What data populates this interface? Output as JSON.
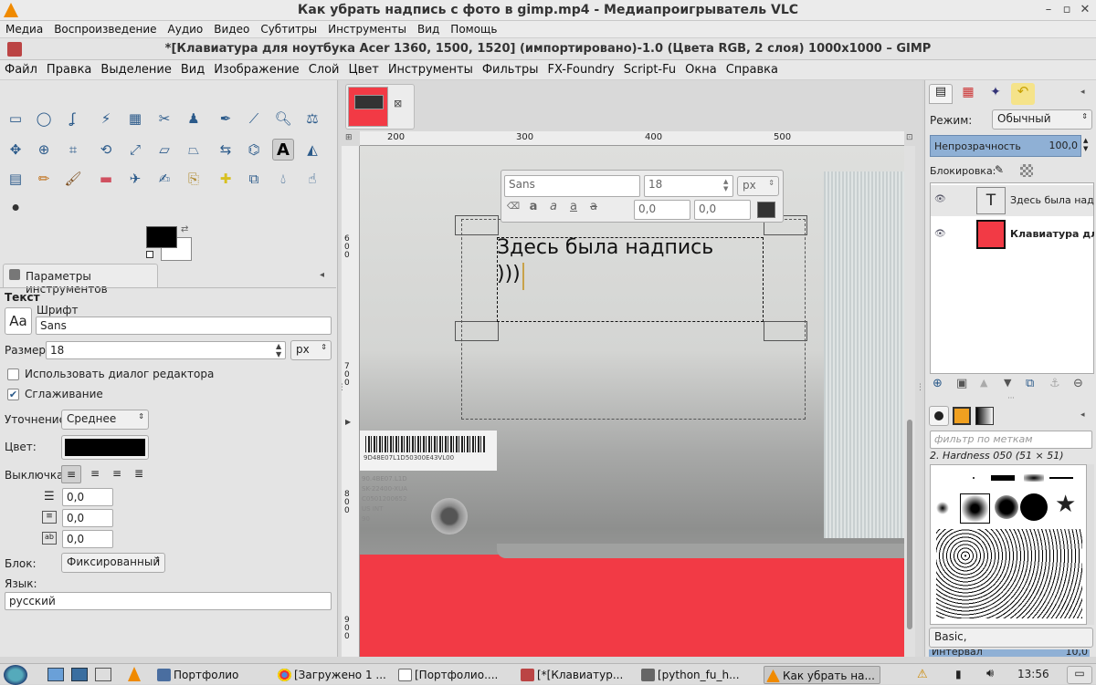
{
  "vlc": {
    "title": "Как убрать надпись с фото в gimp.mp4 - Медиапроигрыватель VLC",
    "menu": [
      "Медиа",
      "Воспроизведение",
      "Аудио",
      "Видео",
      "Субтитры",
      "Инструменты",
      "Вид",
      "Помощь"
    ]
  },
  "gimp": {
    "title": "*[Клавиатура для ноутбука Acer 1360, 1500, 1520] (импортировано)-1.0 (Цвета RGB, 2 слоя) 1000x1000 – GIMP",
    "menu": [
      "Файл",
      "Правка",
      "Выделение",
      "Вид",
      "Изображение",
      "Слой",
      "Цвет",
      "Инструменты",
      "Фильтры",
      "FX-Foundry",
      "Script-Fu",
      "Окна",
      "Справка"
    ]
  },
  "tool_options": {
    "tab_label": "Параметры инструментов",
    "section": "Текст",
    "font_label": "Шрифт",
    "font_value": "Sans",
    "size_label": "Размер:",
    "size_value": "18",
    "size_unit": "px",
    "use_editor_label": "Использовать диалог редактора",
    "antialias_label": "Сглаживание",
    "hinting_label": "Уточнение:",
    "hinting_value": "Среднее",
    "color_label": "Цвет:",
    "justify_label": "Выключка:",
    "indent_value": "0,0",
    "line_spacing_value": "0,0",
    "letter_spacing_value": "0,0",
    "box_label": "Блок:",
    "box_value": "Фиксированный",
    "language_label": "Язык:",
    "language_value": "русский",
    "font_preview": "Aa"
  },
  "rulers": {
    "top": [
      "200",
      "300",
      "400",
      "500"
    ],
    "left": [
      "600",
      "700",
      "800",
      "900"
    ]
  },
  "text_overlay": {
    "font": "Sans",
    "size": "18",
    "unit": "px",
    "baseline": "0,0",
    "kerning": "0,0",
    "canvas_text_line1": "Здесь была надпись",
    "canvas_text_line2": ")))"
  },
  "image_labels": {
    "label_line1": "9D48E07L1D50300E43VL00",
    "sticker_lines": [
      "90.4BE07.L1D",
      "SK-22400-XUA",
      "C0501200652",
      "US INT",
      "90"
    ]
  },
  "layers": {
    "mode_label": "Режим:",
    "mode_value": "Обычный",
    "opacity_label": "Непрозрачность",
    "opacity_value": "100,0",
    "lock_label": "Блокировка:",
    "items": [
      {
        "name": "Здесь была надпись",
        "type": "text"
      },
      {
        "name": "Клавиатура для ноутбука",
        "type": "image"
      }
    ]
  },
  "brushes": {
    "filter_placeholder": "фильтр по меткам",
    "current_brush": "2. Hardness 050 (51 × 51)",
    "preset_value": "Basic,",
    "interval_label": "Интервал",
    "interval_value": "10,0"
  },
  "taskbar": {
    "items": [
      {
        "label": "Портфолио"
      },
      {
        "label": "[Загружено 1 ..."
      },
      {
        "label": "[Портфолио...."
      },
      {
        "label": "[*[Клавиатур..."
      },
      {
        "label": "[python_fu_h..."
      },
      {
        "label": "Как убрать на..."
      }
    ],
    "time": "13:56"
  },
  "colors": {
    "accent": "#8fb0d5",
    "image_red": "#f23a45",
    "fg": "#000000",
    "bg": "#ffffff"
  }
}
